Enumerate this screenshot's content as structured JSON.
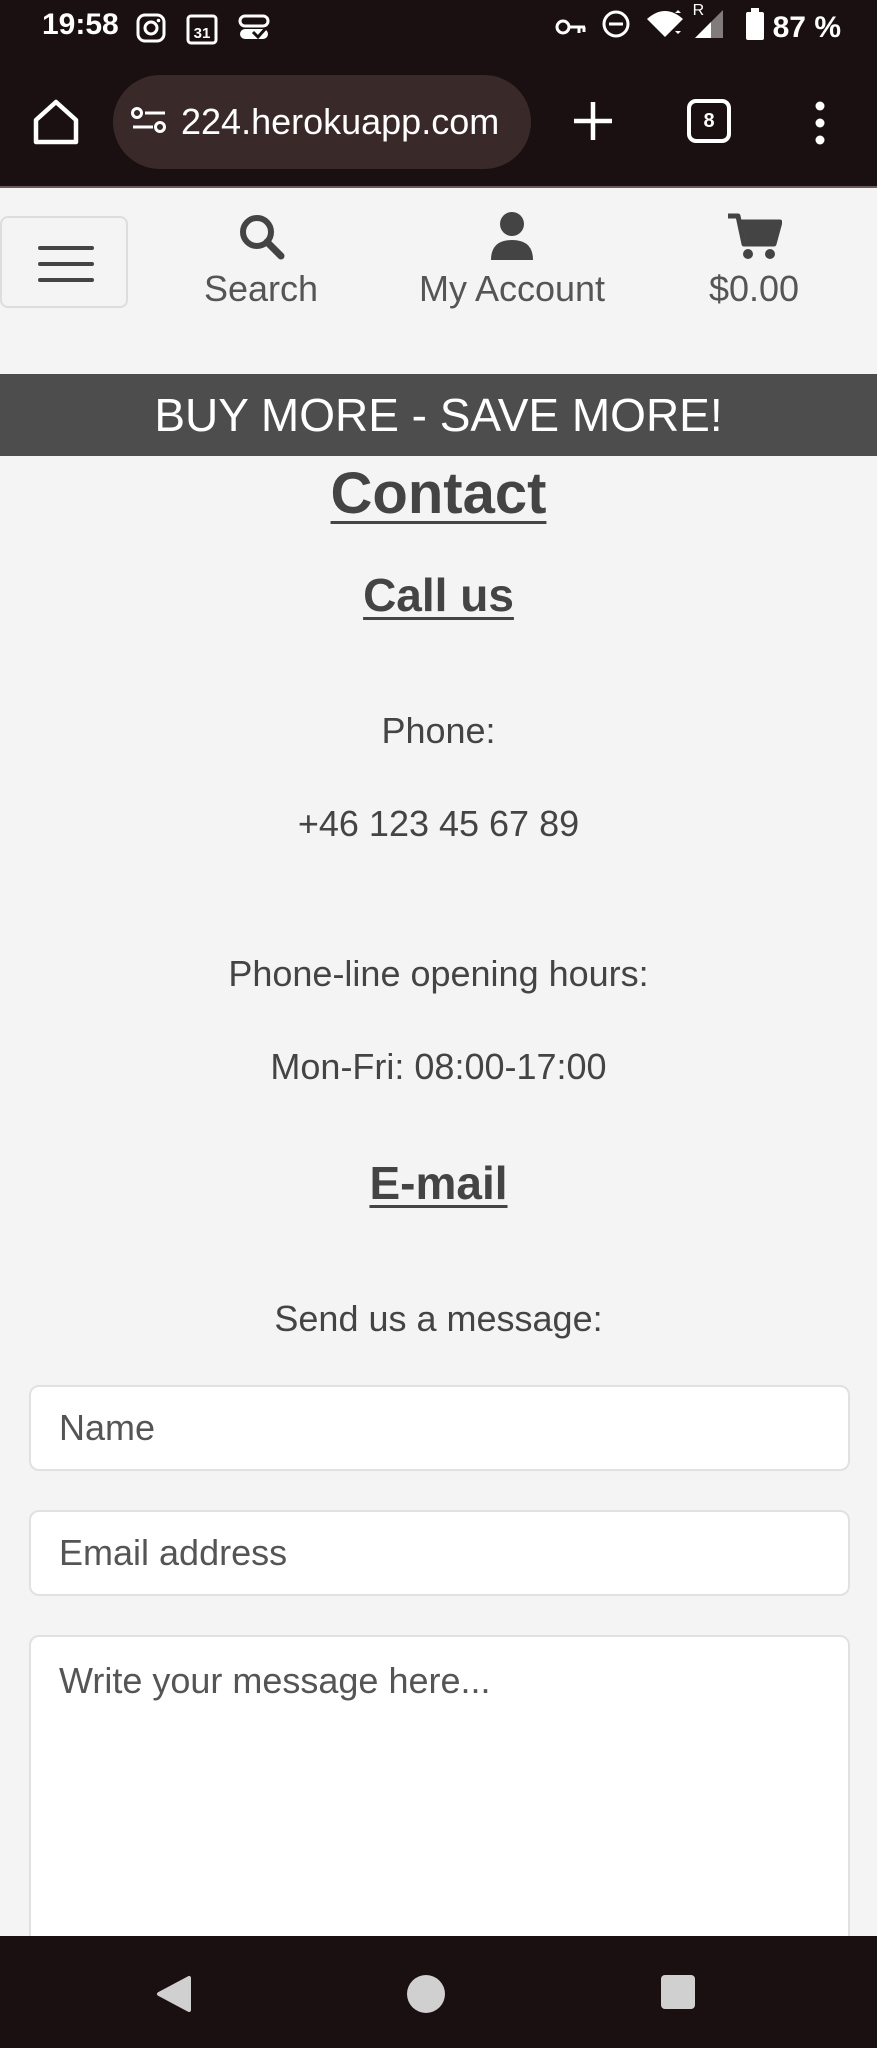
{
  "status_bar": {
    "time": "19:58",
    "calendar_day": "31",
    "battery": "87 %",
    "signal_label": "R"
  },
  "browser": {
    "url": "224.herokuapp.com",
    "tab_count": "8"
  },
  "header": {
    "search_label": "Search",
    "account_label": "My Account",
    "cart_total": "$0.00"
  },
  "banner": {
    "text": "BUY MORE - SAVE MORE!"
  },
  "contact": {
    "title": "Contact",
    "call_heading": "Call us",
    "phone_label": "Phone:",
    "phone_number": "+46 123 45 67 89",
    "hours_label": "Phone-line opening hours:",
    "hours_value": "Mon-Fri: 08:00-17:00",
    "email_heading": "E-mail",
    "message_prompt": "Send us a message:"
  },
  "form": {
    "name_placeholder": "Name",
    "email_placeholder": "Email address",
    "message_placeholder": "Write your message here..."
  },
  "colors": {
    "system_bars": "#1a1011",
    "url_pill": "#392a29",
    "banner": "#4d4d4d",
    "page_bg": "#f4f4f4",
    "text": "#444444"
  }
}
